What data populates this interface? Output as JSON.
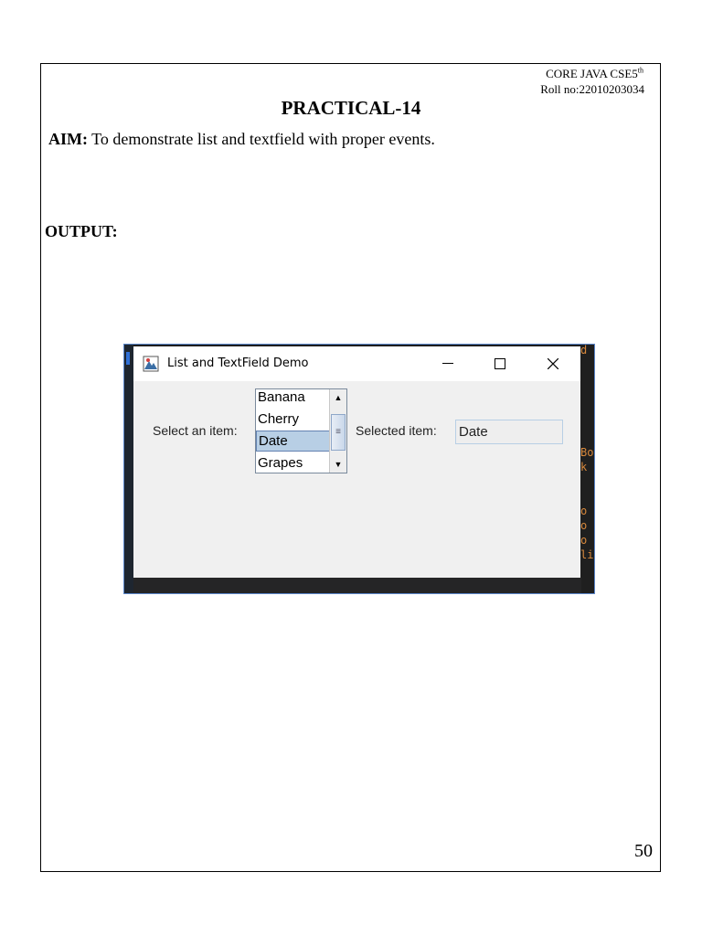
{
  "header": {
    "course": "CORE JAVA CSE5",
    "course_sup": "th",
    "roll": "Roll no:22010203034"
  },
  "title": "PRACTICAL-14",
  "aim": {
    "label": "AIM:",
    "text": " To demonstrate list and textfield with proper events."
  },
  "output_label": "OUTPUT:",
  "page_number": "50",
  "window": {
    "title": "List and TextField Demo",
    "select_label": "Select an item:",
    "list_items": [
      "Banana",
      "Cherry",
      "Date",
      "Grapes"
    ],
    "selected_index": 2,
    "selected_label": "Selected item:",
    "selected_value": "Date",
    "scroll_thumb": "≡",
    "bg_right_text": [
      "d",
      "",
      "",
      "",
      "",
      "",
      "",
      "Bo",
      "k",
      "",
      "",
      "o",
      "o",
      "o",
      "li"
    ]
  },
  "colors": {
    "selection": "#b8cfe5",
    "window_border": "#5b86c9"
  }
}
